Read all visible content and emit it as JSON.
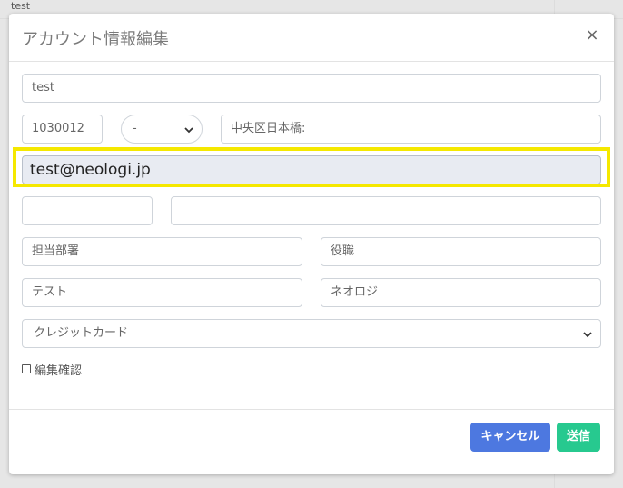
{
  "background": {
    "cell_text": "test"
  },
  "modal": {
    "title": "アカウント情報編集",
    "close_label": "×"
  },
  "form": {
    "name_value": "test",
    "postal_code": "1030012",
    "prefecture_selected": "-",
    "address": "中央区日本橋:",
    "email": "test@neologi.jp",
    "phone_value": "",
    "address2_value": "",
    "department_placeholder": "担当部署",
    "position_placeholder": "役職",
    "last_name_value": "テスト",
    "first_name_value": "ネオロジ",
    "payment_selected": "クレジットカード",
    "confirm_label": "編集確認"
  },
  "footer": {
    "cancel_label": "キャンセル",
    "send_label": "送信"
  },
  "colors": {
    "highlight": "#f5e800",
    "cancel_button": "#4d78e0",
    "send_button": "#27c98f"
  },
  "icons": [
    "close-icon",
    "chevron-down-icon",
    "checkbox-icon"
  ]
}
